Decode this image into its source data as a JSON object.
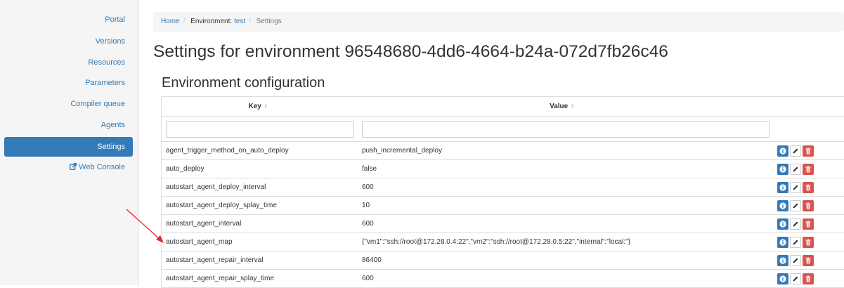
{
  "sidebar": {
    "items": [
      {
        "label": "Portal",
        "active": false
      },
      {
        "label": "Versions",
        "active": false
      },
      {
        "label": "Resources",
        "active": false
      },
      {
        "label": "Parameters",
        "active": false
      },
      {
        "label": "Compiler queue",
        "active": false
      },
      {
        "label": "Agents",
        "active": false
      },
      {
        "label": "Settings",
        "active": true
      },
      {
        "label": "Web Console",
        "icon": "external-link-icon",
        "active": false
      }
    ]
  },
  "breadcrumb": {
    "home": "Home",
    "env_prefix": "Environment:",
    "env_link": "test",
    "current": "Settings"
  },
  "page_title": "Settings for environment 96548680-4dd6-4664-b24a-072d7fb26c46",
  "section_title": "Environment configuration",
  "table": {
    "columns": [
      {
        "label": "Key",
        "sortable": true
      },
      {
        "label": "Value",
        "sortable": true
      }
    ],
    "filter_key_value": "",
    "filter_val_value": "",
    "rows": [
      {
        "key": "agent_trigger_method_on_auto_deploy",
        "value": "push_incremental_deploy"
      },
      {
        "key": "auto_deploy",
        "value": "false"
      },
      {
        "key": "autostart_agent_deploy_interval",
        "value": "600"
      },
      {
        "key": "autostart_agent_deploy_splay_time",
        "value": "10"
      },
      {
        "key": "autostart_agent_interval",
        "value": "600"
      },
      {
        "key": "autostart_agent_map",
        "value": "{\"vm1\":\"ssh://root@172.28.0.4:22\",\"vm2\":\"ssh://root@172.28.0.5:22\",\"internal\":\"local:\"}"
      },
      {
        "key": "autostart_agent_repair_interval",
        "value": "86400"
      },
      {
        "key": "autostart_agent_repair_splay_time",
        "value": "600"
      }
    ],
    "row_actions": [
      "info-icon",
      "pencil-icon",
      "trash-icon"
    ]
  },
  "colors": {
    "primary": "#337ab7",
    "danger": "#d9534f",
    "annotation_arrow": "#e8262a"
  }
}
